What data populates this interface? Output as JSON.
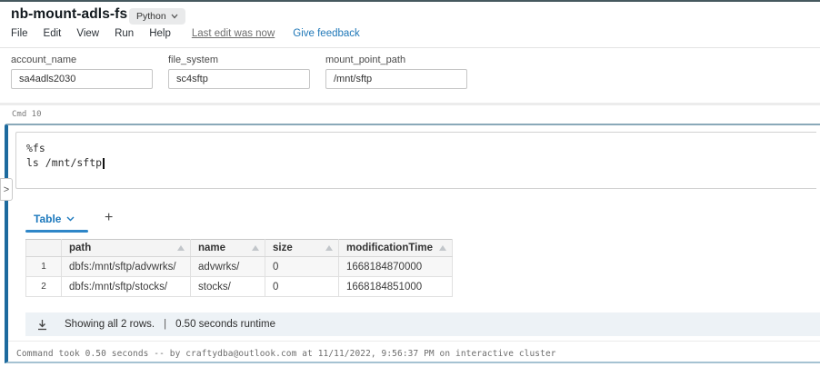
{
  "header": {
    "title": "nb-mount-adls-fs",
    "language_label": "Python",
    "menu_items": [
      "File",
      "Edit",
      "View",
      "Run",
      "Help"
    ],
    "last_edit_label": "Last edit was now",
    "feedback_label": "Give feedback"
  },
  "widgets": [
    {
      "label": "account_name",
      "value": "sa4adls2030"
    },
    {
      "label": "file_system",
      "value": "sc4sftp"
    },
    {
      "label": "mount_point_path",
      "value": "/mnt/sftp"
    }
  ],
  "cell": {
    "label": "Cmd 10",
    "code_lines": [
      "%fs",
      "ls /mnt/sftp"
    ],
    "collapse_handle_glyph": ">"
  },
  "results": {
    "tab_label": "Table",
    "add_tab_label": "+",
    "table": {
      "columns": [
        "path",
        "name",
        "size",
        "modificationTime"
      ],
      "rows": [
        {
          "num": "1",
          "path": "dbfs:/mnt/sftp/advwrks/",
          "name": "advwrks/",
          "size": "0",
          "modificationTime": "1668184870000"
        },
        {
          "num": "2",
          "path": "dbfs:/mnt/sftp/stocks/",
          "name": "stocks/",
          "size": "0",
          "modificationTime": "1668184851000"
        }
      ]
    },
    "footer": {
      "rows_info": "Showing all 2 rows.",
      "separator": "|",
      "runtime": "0.50 seconds runtime"
    }
  },
  "status": {
    "text": "Command took 0.50 seconds -- by craftydba@outlook.com at 11/11/2022, 9:56:37 PM on interactive cluster"
  },
  "colors": {
    "accent_blue": "#2078b8",
    "selected_cell_border": "#1d6a9e",
    "tab_underline": "#2e86c8",
    "footer_band_bg": "#edf2f6",
    "top_bar": "#46595f"
  }
}
